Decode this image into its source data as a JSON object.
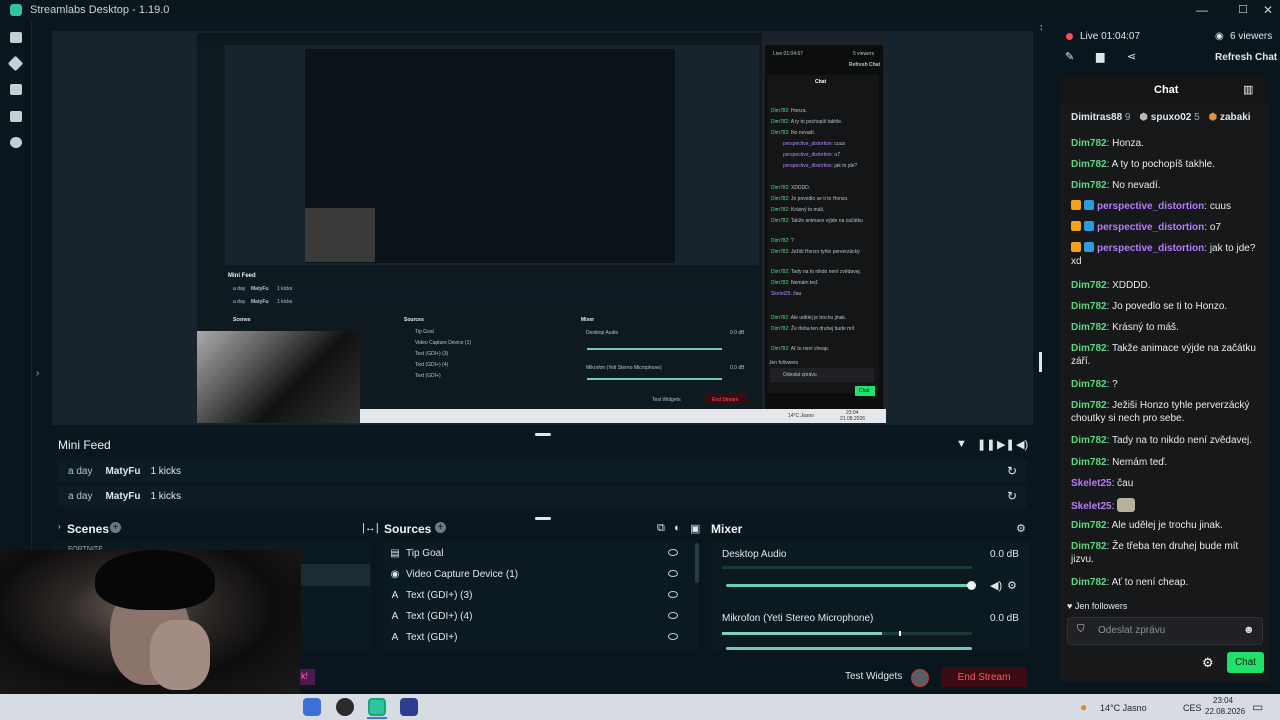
{
  "app": {
    "title": "Streamlabs Desktop - 1.19.0"
  },
  "preview": {
    "inner_chat": {
      "live_time": "Live 01:04:07",
      "viewers": "5 viewers",
      "refresh": "Refresh Chat",
      "title": "Chat",
      "followers": "Jen followers",
      "placeholder": "Odeslat zprávu",
      "send": "Chat"
    },
    "inner_feed": {
      "title": "Mini Feed",
      "rows": [
        {
          "time": "a day",
          "user": "MatyFu",
          "text": "1 kicks"
        },
        {
          "time": "a day",
          "user": "MatyFu",
          "text": "1 kicks"
        }
      ]
    },
    "inner_sections": {
      "scenes": "Scenes",
      "sources": "Sources",
      "mixer": "Mixer"
    },
    "inner_sources": [
      "Tip Goal",
      "Video Capture Device (1)",
      "Text (GDI+) (3)",
      "Text (GDI+) (4)",
      "Text (GDI+)"
    ],
    "inner_mixer": {
      "desktop": "Desktop Audio",
      "desktop_db": "0.0 dB",
      "mic": "Mikrofon (Yeti Stereo Microphone)",
      "mic_db": "0.0 dB"
    },
    "inner_bottom": {
      "test_widgets": "Test Widgets",
      "end_stream": "End Stream"
    },
    "inner_taskbar": {
      "weather": "14°C Jasno",
      "time": "23:04",
      "date": "21.08.2026"
    }
  },
  "minifeed": {
    "title": "Mini Feed",
    "rows": [
      {
        "time": "a day",
        "user": "MatyFu",
        "text": "1 kicks"
      },
      {
        "time": "a day",
        "user": "MatyFu",
        "text": "1 kicks"
      }
    ]
  },
  "scenes": {
    "title": "Scenes",
    "visible_item": "FORTNITE"
  },
  "sources": {
    "title": "Sources",
    "items": [
      {
        "label": "Tip Goal",
        "icon": "tip-goal-icon"
      },
      {
        "label": "Video Capture Device (1)",
        "icon": "camera-icon"
      },
      {
        "label": "Text (GDI+) (3)",
        "icon": "text-icon"
      },
      {
        "label": "Text (GDI+) (4)",
        "icon": "text-icon"
      },
      {
        "label": "Text (GDI+)",
        "icon": "text-icon"
      }
    ]
  },
  "mixer": {
    "title": "Mixer",
    "channels": [
      {
        "name": "Desktop Audio",
        "db": "0.0 dB",
        "volume": 1.0
      },
      {
        "name": "Mikrofon (Yeti Stereo Microphone)",
        "db": "0.0 dB",
        "volume": 1.0
      }
    ]
  },
  "bottom": {
    "overlay_text": "k!",
    "test_widgets": "Test Widgets",
    "end_stream": "End Stream"
  },
  "live": {
    "status": "Live 01:04:07",
    "viewers": "6 viewers",
    "refresh": "Refresh Chat"
  },
  "chat": {
    "title": "Chat",
    "top_users": [
      {
        "name": "Dimitras88",
        "count": "9"
      },
      {
        "name": "spuxo02",
        "count": "5"
      },
      {
        "name": "zabaki",
        "count": ""
      }
    ],
    "messages": [
      {
        "user": "Dim782",
        "text": "Honza.",
        "type": "mod"
      },
      {
        "user": "Dim782",
        "text": "A ty to pochopíš takhle.",
        "type": "mod"
      },
      {
        "user": "Dim782",
        "text": "No nevadí.",
        "type": "mod"
      },
      {
        "user": "perspective_distortion",
        "text": "cuus",
        "type": "badged"
      },
      {
        "user": "perspective_distortion",
        "text": "o7",
        "type": "badged"
      },
      {
        "user": "perspective_distortion",
        "text": "jak to jde? xd",
        "type": "badged"
      },
      {
        "user": "Dim782",
        "text": "XDDDD.",
        "type": "mod"
      },
      {
        "user": "Dim782",
        "text": "Jo povedlo se ti to Honzo.",
        "type": "mod"
      },
      {
        "user": "Dim782",
        "text": "Krásný to máš.",
        "type": "mod"
      },
      {
        "user": "Dim782",
        "text": "Takže animace výjde na začátku září.",
        "type": "mod"
      },
      {
        "user": "Dim782",
        "text": "?",
        "type": "mod"
      },
      {
        "user": "Dim782",
        "text": "Ježiši Honzo tyhle perverzácký choutky si nech pro sebe.",
        "type": "mod"
      },
      {
        "user": "Dim782",
        "text": "Tady na to nikdo není zvědavej.",
        "type": "mod"
      },
      {
        "user": "Dim782",
        "text": "Nemám teď.",
        "type": "mod"
      },
      {
        "user": "Skelet25",
        "text": "čau",
        "type": "purple"
      },
      {
        "user": "Skelet25",
        "text": "",
        "type": "purple-emote"
      },
      {
        "user": "Dim782",
        "text": "Ale udělej je trochu jinak.",
        "type": "mod"
      },
      {
        "user": "Dim782",
        "text": "Že třeba ten druhej bude mít jizvu.",
        "type": "mod"
      },
      {
        "user": "Dim782",
        "text": "Ať to není cheap.",
        "type": "mod"
      }
    ],
    "followers_only": "Jen followers",
    "input_placeholder": "Odeslat zprávu",
    "send_label": "Chat"
  },
  "taskbar": {
    "weather": "14°C Jasno",
    "lang": "CES",
    "time": "23:04",
    "date": "22.08.2026"
  },
  "colors": {
    "accent": "#31c3a2",
    "chat_green": "#20e26a",
    "end_stream": "#ff5a63",
    "panel": "#09161d"
  }
}
